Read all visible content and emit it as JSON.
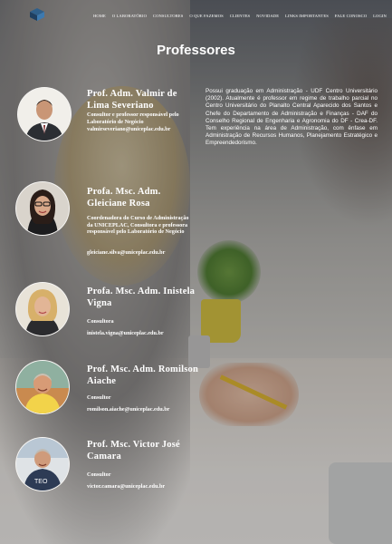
{
  "nav": {
    "logo_icon": "cube-logo-icon",
    "items": [
      "Home",
      "O Laboratório",
      "Consultores",
      "O que fazemos",
      "Clientes",
      "Novidade",
      "Links importantes",
      "Fale conosco",
      "Login"
    ]
  },
  "page": {
    "title": "Professores"
  },
  "professors": [
    {
      "name": "Prof. Adm. Valmir de Lima Severiano",
      "role": "Consultor e professor responsável pelo Laboratório de Negócio",
      "email": "valmirseveriano@uniceplac.edu.br",
      "bio": "Possui graduação em Administração - UDF Centro Universitário (2002). Atualmente é professor em regime de trabalho parcial no Centro Universitário do Planalto Central Aparecido dos Santos e Chefe do Departamento de Administração e Finanças - DAF do Conselho Regional de Engenharia e Agronomia do DF - Crea-DF. Tem experiência na área de Administração, com ênfase em Administração de Recursos Humanos, Planejamento Estratégico e Empreendedorismo."
    },
    {
      "name": "Profa. Msc. Adm. Gleiciane Rosa",
      "role": "Coordenadora do Curso de Administração da UNICEPLAC, Consultora e professora responsável pelo Laboratório de Negócio",
      "email": "gleiciane.silva@uniceplac.edu.br"
    },
    {
      "name": "Profa. Msc. Adm. Inistela Vigna",
      "role": "Consultora",
      "email": "inistela.vigna@uniceplac.edu.br"
    },
    {
      "name": "Prof. Msc. Adm. Romilson Aiache",
      "role": "Consultor",
      "email": "romilson.aiache@uniceplac.edu.br"
    },
    {
      "name": "Prof. Msc. Victor José Camara",
      "role": "Consultor",
      "email": "victor.camara@uniceplac.edu.br"
    }
  ],
  "colors": {
    "text": "#ffffff",
    "overlay": "rgba(20,25,35,0.28)"
  }
}
